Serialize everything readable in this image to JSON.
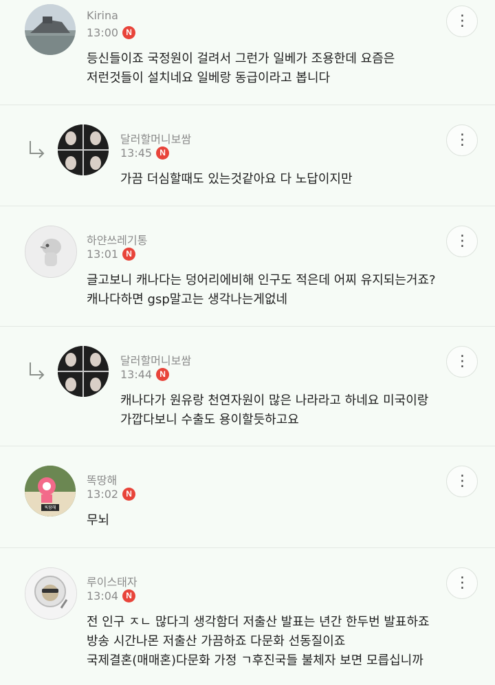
{
  "comments": [
    {
      "author": "Kirina",
      "time": "13:00",
      "badge": "N",
      "reply": false,
      "text": "등신들이죠 국정원이 걸려서 그런가 일베가 조용한데 요즘은\n저런것들이 설치네요 일베랑 동급이라고 봅니다",
      "avatar": "ship-photo"
    },
    {
      "author": "달러할머니보쌈",
      "time": "13:45",
      "badge": "N",
      "reply": true,
      "text": "가끔 더심할때도 있는것같아요 다 노답이지만",
      "avatar": "grid-photo"
    },
    {
      "author": "하얀쓰레기통",
      "time": "13:01",
      "badge": "N",
      "reply": false,
      "text": "글고보니 캐나다는 덩어리에비해 인구도 적은데 어찌 유지되는거죠?\n캐나다하면 gsp말고는 생각나는게없네",
      "avatar": "cartoon-creature"
    },
    {
      "author": "달러할머니보쌈",
      "time": "13:44",
      "badge": "N",
      "reply": true,
      "text": "캐나다가 원유랑 천연자원이 많은 나라라고 하네요 미국이랑\n가깝다보니 수출도 용이할듯하고요",
      "avatar": "grid-photo"
    },
    {
      "author": "똑땅해",
      "time": "13:02",
      "badge": "N",
      "reply": false,
      "text": "무뇌",
      "avatar": "pink-character",
      "avatar_caption": "똑땅해"
    },
    {
      "author": "루이스태자",
      "time": "13:04",
      "badge": "N",
      "reply": false,
      "text": "전 인구 ㅈㄴ 많다긔 생각함더 저출산 발표는 년간 한두번 발표하죠\n방송 시간나몬 저출산 가끔하죠 다문화 선동질이죠\n국제결혼(매매혼)다문화 가정 ㄱ후진국들 불체자 보면 모릅십니까",
      "avatar": "sunglasses-character"
    }
  ],
  "more_icon": "⋮"
}
